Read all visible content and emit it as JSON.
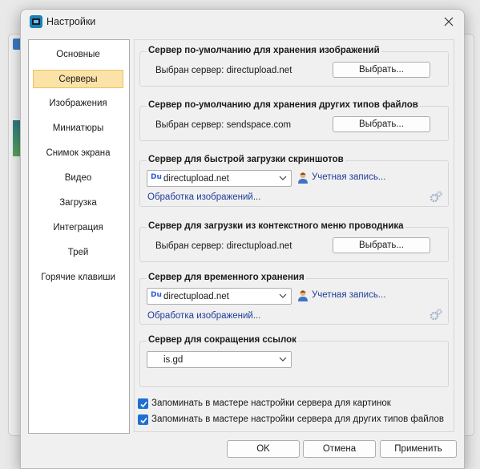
{
  "window": {
    "title": "Настройки"
  },
  "sidebar": {
    "items": [
      {
        "label": "Основные",
        "selected": false
      },
      {
        "label": "Серверы",
        "selected": true
      },
      {
        "label": "Изображения",
        "selected": false
      },
      {
        "label": "Миниатюры",
        "selected": false
      },
      {
        "label": "Снимок экрана",
        "selected": false
      },
      {
        "label": "Видео",
        "selected": false
      },
      {
        "label": "Загрузка",
        "selected": false
      },
      {
        "label": "Интеграция",
        "selected": false
      },
      {
        "label": "Трей",
        "selected": false
      },
      {
        "label": "Горячие клавиши",
        "selected": false
      }
    ]
  },
  "groups": {
    "images": {
      "title": "Сервер по-умолчанию для хранения изображений",
      "selected_text": "Выбран сервер: directupload.net",
      "button": "Выбрать..."
    },
    "files": {
      "title": "Сервер по-умолчанию для хранения других типов файлов",
      "selected_text": "Выбран сервер: sendspace.com",
      "button": "Выбрать..."
    },
    "quick": {
      "title": "Сервер для быстрой загрузки скриншотов",
      "combo_value": "directupload.net",
      "account": "Учетная запись...",
      "link": "Обработка изображений..."
    },
    "context": {
      "title": "Сервер для загрузки из контекстного меню проводника",
      "selected_text": "Выбран сервер: directupload.net",
      "button": "Выбрать..."
    },
    "temp": {
      "title": "Сервер для временного хранения",
      "combo_value": "directupload.net",
      "account": "Учетная запись...",
      "link": "Обработка изображений..."
    },
    "shortener": {
      "title": "Сервер для сокращения ссылок",
      "combo_value": "is.gd"
    }
  },
  "checkboxes": [
    {
      "label": "Запоминать в мастере настройки сервера для картинок",
      "checked": true
    },
    {
      "label": "Запоминать в мастере настройки сервера для других типов файлов",
      "checked": true
    }
  ],
  "buttons": {
    "ok": "OK",
    "cancel": "Отмена",
    "apply": "Применить"
  },
  "colors": {
    "accent": "#1f6fd1",
    "selected_item": "#fbe2a6",
    "link": "#1f3d99"
  }
}
